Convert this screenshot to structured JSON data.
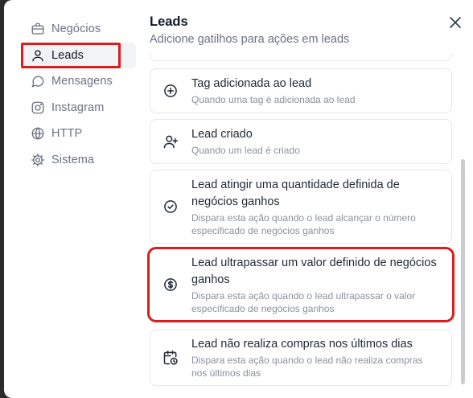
{
  "sidebar": {
    "items": [
      {
        "label": "Negócios",
        "icon": "briefcase-icon"
      },
      {
        "label": "Leads",
        "icon": "user-icon"
      },
      {
        "label": "Mensagens",
        "icon": "message-circle-icon"
      },
      {
        "label": "Instagram",
        "icon": "instagram-icon"
      },
      {
        "label": "HTTP",
        "icon": "globe-icon"
      },
      {
        "label": "Sistema",
        "icon": "gear-icon"
      }
    ],
    "active_index": 1
  },
  "header": {
    "title": "Leads",
    "subtitle": "Adicione gatilhos para ações em leads"
  },
  "triggers": [
    {
      "title": "Tag adicionada ao lead",
      "description": "Quando uma tag é adicionada ao lead",
      "icon": "tag-plus-icon"
    },
    {
      "title": "Lead criado",
      "description": "Quando um lead é criado",
      "icon": "user-plus-icon"
    },
    {
      "title": "Lead atingir uma quantidade definida de negócios ganhos",
      "description": "Dispara esta ação quando o lead alcançar o número especificado de negócios ganhos",
      "icon": "check-circle-icon"
    },
    {
      "title": "Lead ultrapassar um valor definido de negócios ganhos",
      "description": "Dispara esta ação quando o lead ultrapassar o valor especificado de negócios ganhos",
      "icon": "dollar-circle-icon"
    },
    {
      "title": "Lead não realiza compras nos últimos dias",
      "description": "Dispara esta ação quando o lead não realiza compras nos últimos dias",
      "icon": "calendar-clock-icon"
    }
  ],
  "colors": {
    "highlight": "#d81e1e",
    "active_bg": "#f1f3f5",
    "muted_text": "#6b7280",
    "border": "#e5e7eb"
  }
}
